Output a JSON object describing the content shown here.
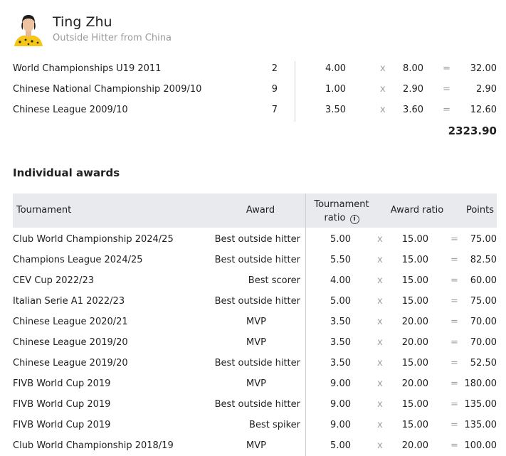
{
  "player": {
    "name": "Ting Zhu",
    "subtitle": "Outside Hitter from China"
  },
  "team_rows": [
    {
      "tournament": "World Championships U19 2011",
      "count": "2",
      "ratio": "4.00",
      "x": "x",
      "mult": "8.00",
      "eq": "=",
      "points": "32.00"
    },
    {
      "tournament": "Chinese National Championship 2009/10",
      "count": "9",
      "ratio": "1.00",
      "x": "x",
      "mult": "2.90",
      "eq": "=",
      "points": "2.90"
    },
    {
      "tournament": "Chinese League 2009/10",
      "count": "7",
      "ratio": "3.50",
      "x": "x",
      "mult": "3.60",
      "eq": "=",
      "points": "12.60"
    }
  ],
  "team_total": "2323.90",
  "awards_section": {
    "title": "Individual awards",
    "headers": {
      "tournament": "Tournament",
      "award": "Award",
      "tournament_ratio_line1": "Tournament",
      "tournament_ratio_line2": "ratio",
      "info_glyph": "i",
      "award_ratio": "Award ratio",
      "points": "Points"
    },
    "rows": [
      {
        "tournament": "Club World Championship 2024/25",
        "award": "Best outside hitter",
        "tratio": "5.00",
        "x": "x",
        "aratio": "15.00",
        "eq": "=",
        "points": "75.00"
      },
      {
        "tournament": "Champions League 2024/25",
        "award": "Best outside hitter",
        "tratio": "5.50",
        "x": "x",
        "aratio": "15.00",
        "eq": "=",
        "points": "82.50"
      },
      {
        "tournament": "CEV Cup 2022/23",
        "award": "Best scorer",
        "tratio": "4.00",
        "x": "x",
        "aratio": "15.00",
        "eq": "=",
        "points": "60.00"
      },
      {
        "tournament": "Italian Serie A1 2022/23",
        "award": "Best outside hitter",
        "tratio": "5.00",
        "x": "x",
        "aratio": "15.00",
        "eq": "=",
        "points": "75.00"
      },
      {
        "tournament": "Chinese League 2020/21",
        "award": "MVP",
        "tratio": "3.50",
        "x": "x",
        "aratio": "20.00",
        "eq": "=",
        "points": "70.00"
      },
      {
        "tournament": "Chinese League 2019/20",
        "award": "MVP",
        "tratio": "3.50",
        "x": "x",
        "aratio": "20.00",
        "eq": "=",
        "points": "70.00"
      },
      {
        "tournament": "Chinese League 2019/20",
        "award": "Best outside hitter",
        "tratio": "3.50",
        "x": "x",
        "aratio": "15.00",
        "eq": "=",
        "points": "52.50"
      },
      {
        "tournament": "FIVB World Cup 2019",
        "award": "MVP",
        "tratio": "9.00",
        "x": "x",
        "aratio": "20.00",
        "eq": "=",
        "points": "180.00"
      },
      {
        "tournament": "FIVB World Cup 2019",
        "award": "Best outside hitter",
        "tratio": "9.00",
        "x": "x",
        "aratio": "15.00",
        "eq": "=",
        "points": "135.00"
      },
      {
        "tournament": "FIVB World Cup 2019",
        "award": "Best spiker",
        "tratio": "9.00",
        "x": "x",
        "aratio": "15.00",
        "eq": "=",
        "points": "135.00"
      },
      {
        "tournament": "Club World Championship 2018/19",
        "award": "MVP",
        "tratio": "5.00",
        "x": "x",
        "aratio": "20.00",
        "eq": "=",
        "points": "100.00"
      }
    ]
  },
  "colors": {
    "header_bg": "#e8eaed",
    "muted": "#9a9a9a",
    "jersey": "#f5c518"
  }
}
